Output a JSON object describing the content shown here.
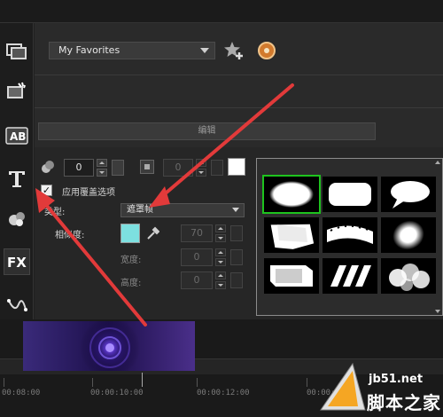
{
  "favorites": {
    "selected": "My Favorites"
  },
  "edit_tab": {
    "label": "编辑"
  },
  "overlay": {
    "field1_value": "0",
    "field2_value": "0",
    "apply_overlay_label": "应用覆盖选项",
    "type_label": "类型:",
    "type_value": "遮罩帧",
    "opacity_label": "相似度:",
    "opacity_value": "70",
    "width_label": "宽度:",
    "width_value": "0",
    "height_label": "高度:",
    "height_value": "0",
    "swatch_color": "#7de0e0"
  },
  "masks": [
    {
      "name": "oval",
      "selected": true
    },
    {
      "name": "rounded-rectangle",
      "selected": false
    },
    {
      "name": "speech-bubble",
      "selected": false
    },
    {
      "name": "torn-paper",
      "selected": false
    },
    {
      "name": "film-strip",
      "selected": false
    },
    {
      "name": "soft-oval",
      "selected": false
    },
    {
      "name": "brush-stroke",
      "selected": false
    },
    {
      "name": "stripes",
      "selected": false
    },
    {
      "name": "circles",
      "selected": false
    }
  ],
  "timeline": {
    "ticks": [
      "00:08:00",
      "00:00:10:00",
      "00:00:12:00",
      "00:00:14:00"
    ]
  },
  "watermark": {
    "site": "jb51.net",
    "text": "脚本之家"
  },
  "colors": {
    "accent_green": "#1ec31e",
    "arrow_red": "#e23a3a"
  }
}
